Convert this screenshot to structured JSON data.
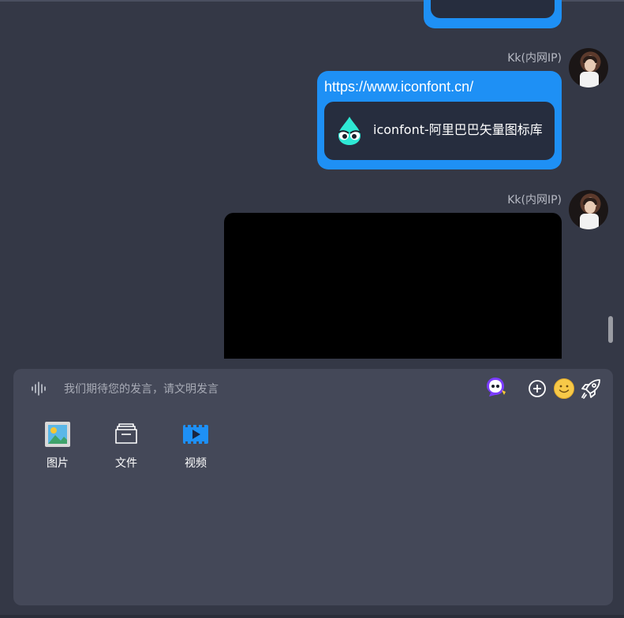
{
  "chat": {
    "messages": [
      {
        "sender": "Kk(内网IP)",
        "type": "link",
        "url": "https://www.iconfont.cn/",
        "card_title": "iconfont-阿里巴巴矢量图标库"
      },
      {
        "sender": "Kk(内网IP)",
        "type": "video"
      }
    ]
  },
  "input": {
    "placeholder": "我们期待您的发言，请文明发言"
  },
  "tools": [
    {
      "label": "图片",
      "icon": "image-icon"
    },
    {
      "label": "文件",
      "icon": "file-icon"
    },
    {
      "label": "视频",
      "icon": "video-icon"
    }
  ],
  "colors": {
    "background": "#343846",
    "bubble": "#1e90f5",
    "card": "#262d3e",
    "panel": "#444858"
  }
}
